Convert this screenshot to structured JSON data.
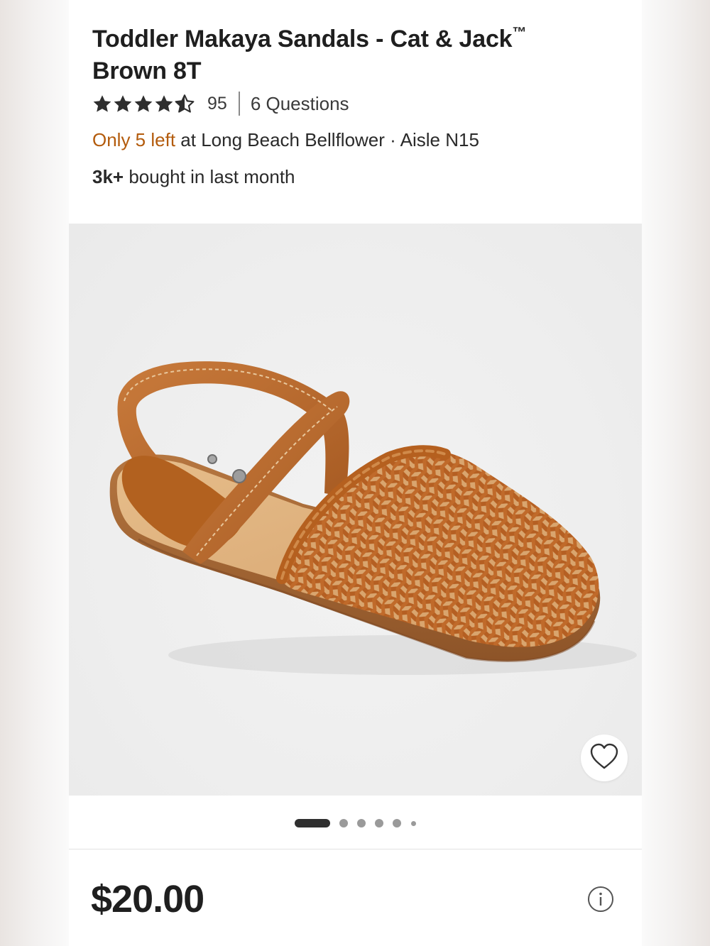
{
  "product": {
    "title": "Toddler Makaya Sandals - Cat & Jack",
    "trademark": "™",
    "variant": "Brown 8T",
    "rating": 4.5,
    "rating_max": 5,
    "review_count": "95",
    "questions_label": "6 Questions"
  },
  "stock": {
    "low_stock_text": "Only 5 left",
    "location_text": "at Long Beach Bellflower",
    "separator": "·",
    "aisle_text": "Aisle N15"
  },
  "social_proof": {
    "bold_text": "3k+",
    "rest_text": "bought in last month"
  },
  "gallery": {
    "image_description_icon": "sandal-product-image",
    "favorite_icon": "heart-icon",
    "dots_total": 6,
    "active_index": 0
  },
  "pricing": {
    "price": "$20.00",
    "info_icon": "info-icon"
  },
  "colors": {
    "title_text": "#1f1f1f",
    "low_stock": "#b35b0c",
    "star_fill": "#2e2e2e",
    "image_bg": "#eeeeee",
    "leather": "#b8652a",
    "insole": "#ddb07a",
    "sole": "#a86a3a"
  }
}
